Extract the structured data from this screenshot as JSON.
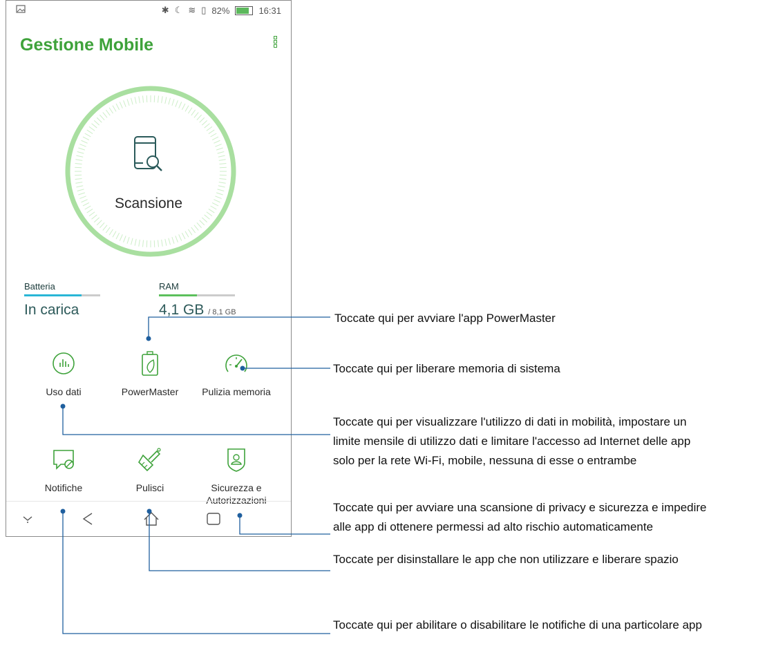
{
  "status_bar": {
    "battery": "82%",
    "time": "16:31"
  },
  "app": {
    "title": "Gestione Mobile"
  },
  "scan": {
    "label": "Scansione"
  },
  "stats": {
    "battery": {
      "label": "Batteria",
      "value": "In carica",
      "level": 0.75,
      "color": "#29b6d6"
    },
    "ram": {
      "label": "RAM",
      "value": "4,1 GB",
      "total": "/ 8,1 GB",
      "level": 0.5,
      "color": "#5cc05c"
    }
  },
  "tiles": [
    {
      "label": "Uso dati",
      "icon": "data-usage-icon"
    },
    {
      "label": "PowerMaster",
      "icon": "battery-leaf-icon"
    },
    {
      "label": "Pulizia memoria",
      "icon": "speedometer-icon"
    },
    {
      "label": "Notifiche",
      "icon": "notification-block-icon"
    },
    {
      "label": "Pulisci",
      "icon": "brush-icon"
    },
    {
      "label": "Sicurezza e\nAutorizzazioni",
      "label_line1": "Sicurezza e",
      "label_line2": "Autorizzazioni",
      "icon": "shield-user-icon"
    }
  ],
  "callouts": {
    "powermaster": "Toccate qui per avviare l'app PowerMaster",
    "memory": "Toccate qui per liberare memoria di sistema",
    "data_line1": "Toccate qui per visualizzare l'utilizzo di dati in mobilità, impostare un",
    "data_line2": "limite mensile di utilizzo dati e limitare l'accesso ad Internet delle app",
    "data_line3": "solo per la rete Wi-Fi, mobile, nessuna di esse o entrambe",
    "security_line1": "Toccate qui per avviare una scansione di privacy e sicurezza e impedire",
    "security_line2": "alle app di ottenere permessi ad alto rischio automaticamente",
    "clean": "Toccate per disinstallare le app che non utilizzare e liberare spazio",
    "notifications": "Toccate qui per abilitare o disabilitare le notifiche di una particolare app"
  },
  "colors": {
    "accent": "#3ea23a",
    "callout_line": "#1f5f9e"
  }
}
